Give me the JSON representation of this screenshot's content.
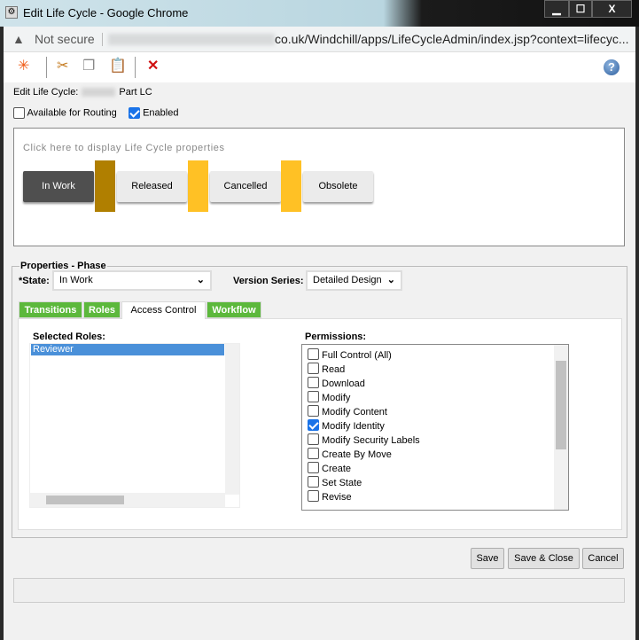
{
  "window": {
    "title": "Edit Life Cycle - Google Chrome",
    "minimize": "▁",
    "maximize": "☐",
    "close": "X"
  },
  "address": {
    "security": "Not secure",
    "url": "co.uk/Windchill/apps/LifeCycleAdmin/index.jsp?context=lifecyc..."
  },
  "toolbar": {
    "icons": [
      "new-icon",
      "cut-icon",
      "copy-icon",
      "paste-icon",
      "delete-icon",
      "help-icon"
    ],
    "help": "?"
  },
  "header": {
    "label": "Edit Life Cycle:",
    "name": "Part LC"
  },
  "options": {
    "routing": "Available for Routing",
    "routing_checked": false,
    "enabled": "Enabled",
    "enabled_checked": true
  },
  "lifecycle": {
    "hint": "Click here to display Life Cycle properties",
    "states": [
      "In Work",
      "Released",
      "Cancelled",
      "Obsolete"
    ],
    "current": "In Work",
    "connector_colors": [
      "#b07f00",
      "#ffc125",
      "#ffc125"
    ]
  },
  "properties": {
    "legend": "Properties - Phase",
    "state_label": "*State:",
    "state_value": "In Work",
    "version_label": "Version Series:",
    "version_value": "Detailed Design"
  },
  "tabs": [
    "Transitions",
    "Roles",
    "Access Control",
    "Workflow"
  ],
  "access": {
    "roles_label": "Selected Roles:",
    "roles": [
      "Reviewer"
    ],
    "perms_label": "Permissions:",
    "permissions": [
      {
        "label": "Full Control (All)",
        "checked": false
      },
      {
        "label": "Read",
        "checked": false
      },
      {
        "label": "Download",
        "checked": false
      },
      {
        "label": "Modify",
        "checked": false
      },
      {
        "label": "Modify Content",
        "checked": false
      },
      {
        "label": "Modify Identity",
        "checked": true
      },
      {
        "label": "Modify Security Labels",
        "checked": false
      },
      {
        "label": "Create By Move",
        "checked": false
      },
      {
        "label": "Create",
        "checked": false
      },
      {
        "label": "Set State",
        "checked": false
      },
      {
        "label": "Revise",
        "checked": false
      }
    ]
  },
  "buttons": {
    "save": "Save",
    "save_close": "Save & Close",
    "cancel": "Cancel"
  }
}
